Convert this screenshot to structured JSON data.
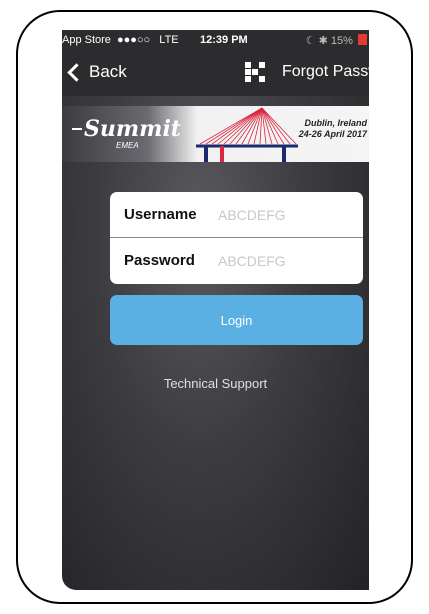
{
  "status_bar": {
    "carrier": "App Store",
    "signal": "●●●○○",
    "network": "LTE",
    "time": "12:39 PM",
    "battery": "15%"
  },
  "nav": {
    "back_label": "Back",
    "forgot_label": "Forgot Password"
  },
  "banner": {
    "logo_text": "Summit",
    "logo_sub": "EMEA",
    "location": "Dublin, Ireland",
    "dates": "24-26 April 2017"
  },
  "login": {
    "username_label": "Username",
    "username_placeholder": "ABCDEFG",
    "password_label": "Password",
    "password_placeholder": "ABCDEFG",
    "button_label": "Login"
  },
  "support": {
    "label": "Technical Support"
  },
  "colors": {
    "accent": "#5ab0e3",
    "battery_low": "#e53935"
  },
  "icons": [
    "back-chevron-icon",
    "qr-code-icon",
    "bluetooth-icon",
    "battery-icon"
  ]
}
